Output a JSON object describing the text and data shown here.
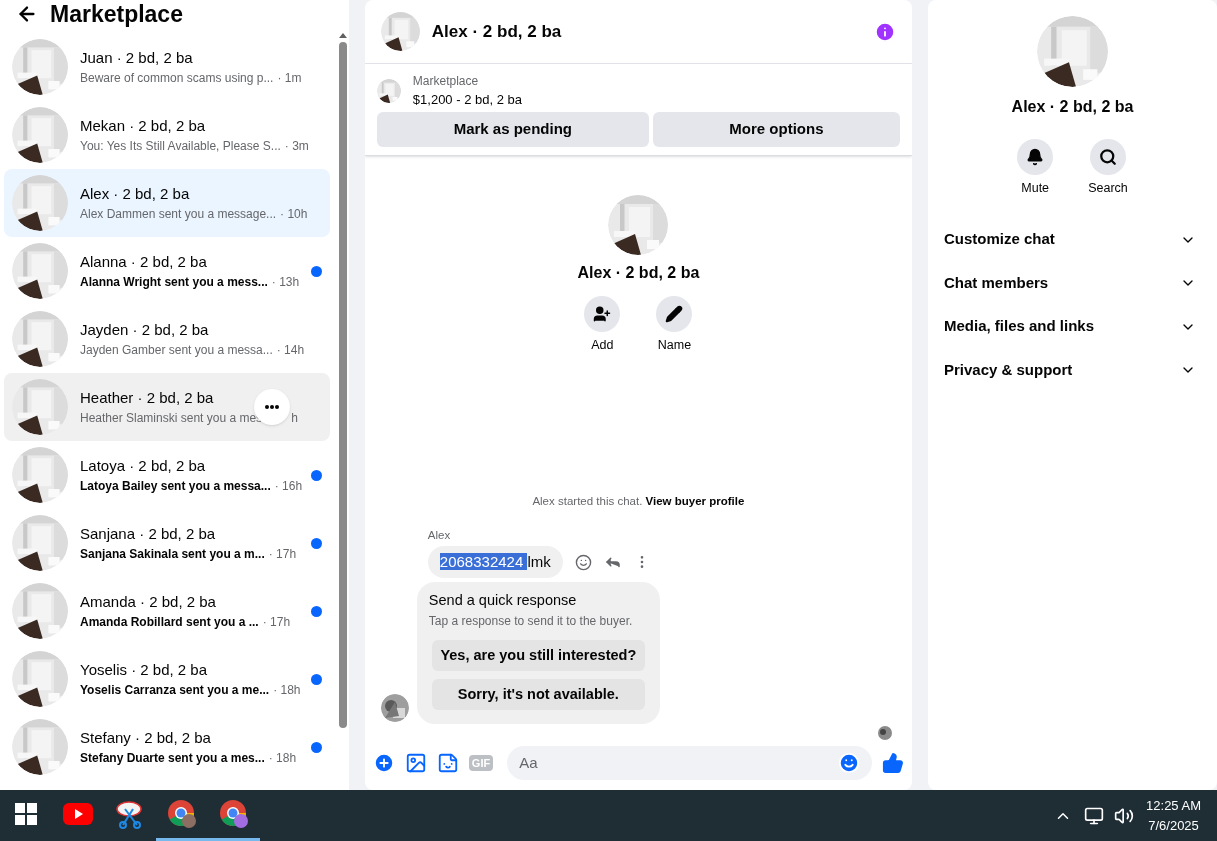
{
  "sidebar": {
    "title": "Marketplace",
    "conversations": [
      {
        "name": "Juan · 2 bd, 2 ba",
        "preview": "Beware of common scams using p...",
        "time": "· 1m",
        "unread": false,
        "selected": false,
        "hovered": false
      },
      {
        "name": "Mekan · 2 bd, 2 ba",
        "preview": "You: Yes Its Still Available, Please S...",
        "time": "· 3m",
        "unread": false,
        "selected": false,
        "hovered": false
      },
      {
        "name": "Alex · 2 bd, 2 ba",
        "preview": "Alex Dammen sent you a message...",
        "time": "· 10h",
        "unread": false,
        "selected": true,
        "hovered": false
      },
      {
        "name": "Alanna · 2 bd, 2 ba",
        "preview": "Alanna Wright sent you a mess...",
        "time": "· 13h",
        "unread": true,
        "selected": false,
        "hovered": false
      },
      {
        "name": "Jayden · 2 bd, 2 ba",
        "preview": "Jayden Gamber sent you a messa...",
        "time": "· 14h",
        "unread": false,
        "selected": false,
        "hovered": false
      },
      {
        "name": "Heather · 2 bd, 2 ba",
        "preview": "Heather Slaminski sent you a mes",
        "time": "h",
        "unread": false,
        "selected": false,
        "hovered": true
      },
      {
        "name": "Latoya · 2 bd, 2 ba",
        "preview": "Latoya Bailey sent you a messa...",
        "time": "· 16h",
        "unread": true,
        "selected": false,
        "hovered": false
      },
      {
        "name": "Sanjana · 2 bd, 2 ba",
        "preview": "Sanjana Sakinala sent you a m...",
        "time": "· 17h",
        "unread": true,
        "selected": false,
        "hovered": false
      },
      {
        "name": "Amanda · 2 bd, 2 ba",
        "preview": "Amanda Robillard sent you a ...",
        "time": "· 17h",
        "unread": true,
        "selected": false,
        "hovered": false
      },
      {
        "name": "Yoselis · 2 bd, 2 ba",
        "preview": "Yoselis Carranza sent you a me...",
        "time": "· 18h",
        "unread": true,
        "selected": false,
        "hovered": false
      },
      {
        "name": "Stefany · 2 bd, 2 ba",
        "preview": "Stefany Duarte sent you a mes...",
        "time": "· 18h",
        "unread": true,
        "selected": false,
        "hovered": false
      }
    ]
  },
  "chat": {
    "title": "Alex · 2 bd, 2 ba",
    "listing": {
      "source": "Marketplace",
      "price": "$1,200 - 2 bd, 2 ba"
    },
    "actions": [
      "Mark as pending",
      "More options"
    ],
    "profile": {
      "name": "Alex · 2 bd, 2 ba",
      "buttons": [
        "Add",
        "Name"
      ]
    },
    "notice": {
      "text": "Alex started this chat.",
      "link": "View buyer profile"
    },
    "message": {
      "sender": "Alex",
      "parts": [
        {
          "text": "2068332424 ",
          "selected": true
        },
        {
          "text": "lmk",
          "selected": false
        }
      ]
    },
    "quick_response": {
      "title": "Send a quick response",
      "subtitle": "Tap a response to send it to the buyer.",
      "options": [
        "Yes, are you still interested?",
        "Sorry, it's not available."
      ]
    },
    "composer": {
      "gif": "GIF",
      "placeholder": "Aa"
    }
  },
  "details": {
    "name": "Alex · 2 bd, 2 ba",
    "buttons": [
      {
        "kind": "mute",
        "label": "Mute"
      },
      {
        "kind": "search",
        "label": "Search"
      }
    ],
    "sections": [
      {
        "label": "Customize chat",
        "expanded": false
      },
      {
        "label": "Chat members",
        "expanded": false
      },
      {
        "label": "Media, files and links",
        "expanded": false
      },
      {
        "label": "Privacy & support",
        "expanded": false
      }
    ]
  },
  "taskbar": {
    "apps": [
      {
        "kind": "windows",
        "active": false
      },
      {
        "kind": "youtube",
        "active": false
      },
      {
        "kind": "snip",
        "active": false
      },
      {
        "kind": "chrome",
        "active": true
      },
      {
        "kind": "chrome",
        "active": true
      }
    ],
    "time": "12:25 AM",
    "date": "7/6/2025"
  }
}
